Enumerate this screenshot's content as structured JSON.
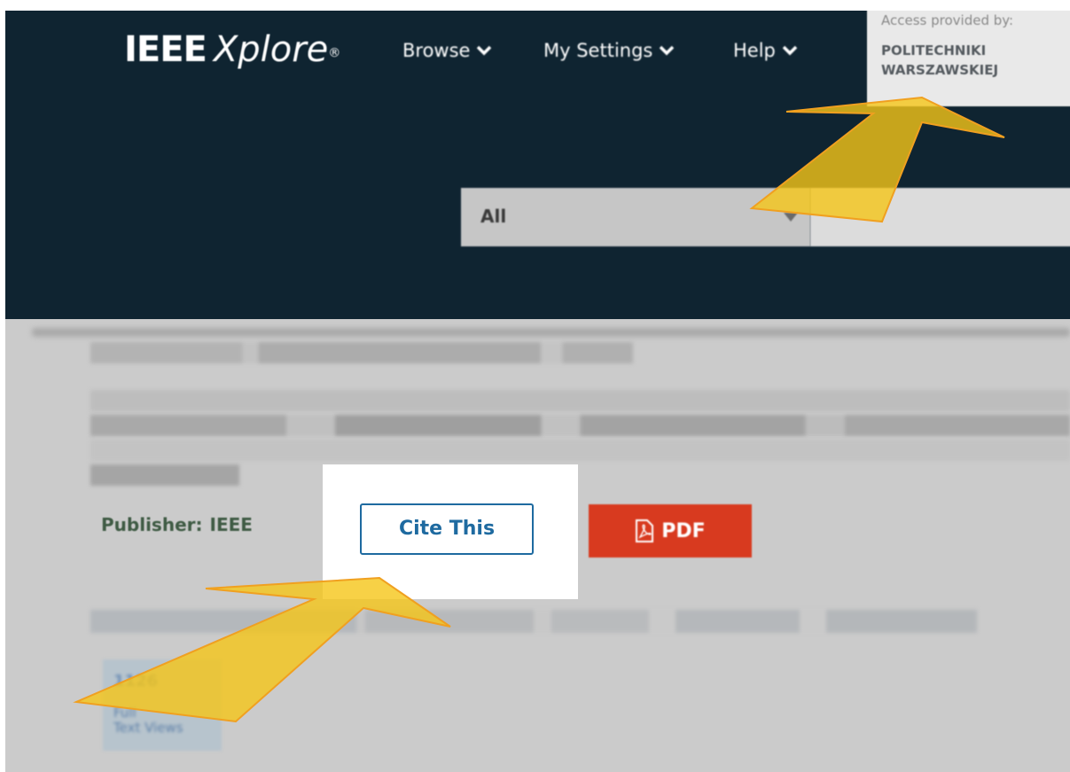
{
  "header": {
    "logo_ieee": "IEEE",
    "logo_xplore": "Xplore",
    "logo_mark": "®",
    "nav": {
      "browse": "Browse",
      "my_settings": "My Settings",
      "help": "Help"
    },
    "access": {
      "label": "Access provided by:",
      "org_line1": "POLITECHNIKI",
      "org_line2": "WARSZAWSKIEJ"
    },
    "search": {
      "scope_value": "All",
      "input_value": ""
    }
  },
  "article": {
    "publisher_label": "Publisher:",
    "publisher_value": "IEEE",
    "cite_label": "Cite This",
    "pdf_label": "PDF",
    "metrics": {
      "views_count": "1126",
      "views_label_line1": "Full",
      "views_label_line2": "Text Views"
    }
  },
  "colors": {
    "header_bg": "#0f2431",
    "body_bg": "#cbcbcb",
    "cite_accent": "#1e6aa0",
    "pdf_red": "#d83a1f",
    "annotation_arrow": "#f5c518"
  },
  "icons": [
    "chevron-down-icon",
    "pdf-file-icon",
    "dropdown-caret-icon",
    "annotation-arrow"
  ]
}
